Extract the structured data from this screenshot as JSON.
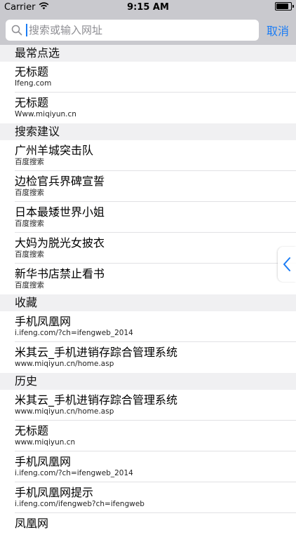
{
  "statusbar": {
    "carrier": "Carrier",
    "time": "9:15 AM",
    "wifi_icon": "wifi-icon",
    "battery_icon": "battery-icon"
  },
  "search": {
    "placeholder": "搜索或输入网址",
    "cancel_label": "取消",
    "accent_color": "#1a7cf5"
  },
  "sections": {
    "favorites": {
      "header": "最常点选",
      "items": [
        {
          "title": "无标题",
          "subtitle": "Ifeng.com"
        },
        {
          "title": "无标题",
          "subtitle": "Www.miqiyun.cn"
        }
      ]
    },
    "suggestions": {
      "header": "搜索建议",
      "items": [
        {
          "title": "广州羊城突击队",
          "subtitle": "百度搜索"
        },
        {
          "title": "边检官兵界碑宣誓",
          "subtitle": "百度搜索"
        },
        {
          "title": "日本最矮世界小姐",
          "subtitle": "百度搜索"
        },
        {
          "title": "大妈为脱光女披衣",
          "subtitle": "百度搜索"
        },
        {
          "title": "新华书店禁止看书",
          "subtitle": "百度搜索"
        }
      ]
    },
    "bookmarks": {
      "header": "收藏",
      "items": [
        {
          "title": "手机凤凰网",
          "subtitle": "i.ifeng.com/?ch=ifengweb_2014"
        },
        {
          "title": "米其云_手机进销存踪合管理系统",
          "subtitle": "www.miqiyun.cn/home.asp"
        }
      ]
    },
    "history": {
      "header": "历史",
      "items": [
        {
          "title": "米其云_手机进销存踪合管理系统",
          "subtitle": "www.miqiyun.cn/home.asp"
        },
        {
          "title": "无标题",
          "subtitle": "www.miqiyun.cn"
        },
        {
          "title": "手机凤凰网",
          "subtitle": "i.ifeng.com/?ch=ifengweb_2014"
        },
        {
          "title": "手机凤凰网提示",
          "subtitle": "i.ifeng.com/ifengweb?ch=ifengweb"
        },
        {
          "title": "凤凰网",
          "subtitle": ""
        }
      ]
    }
  },
  "side_handle_icon": "chevron-left-icon"
}
